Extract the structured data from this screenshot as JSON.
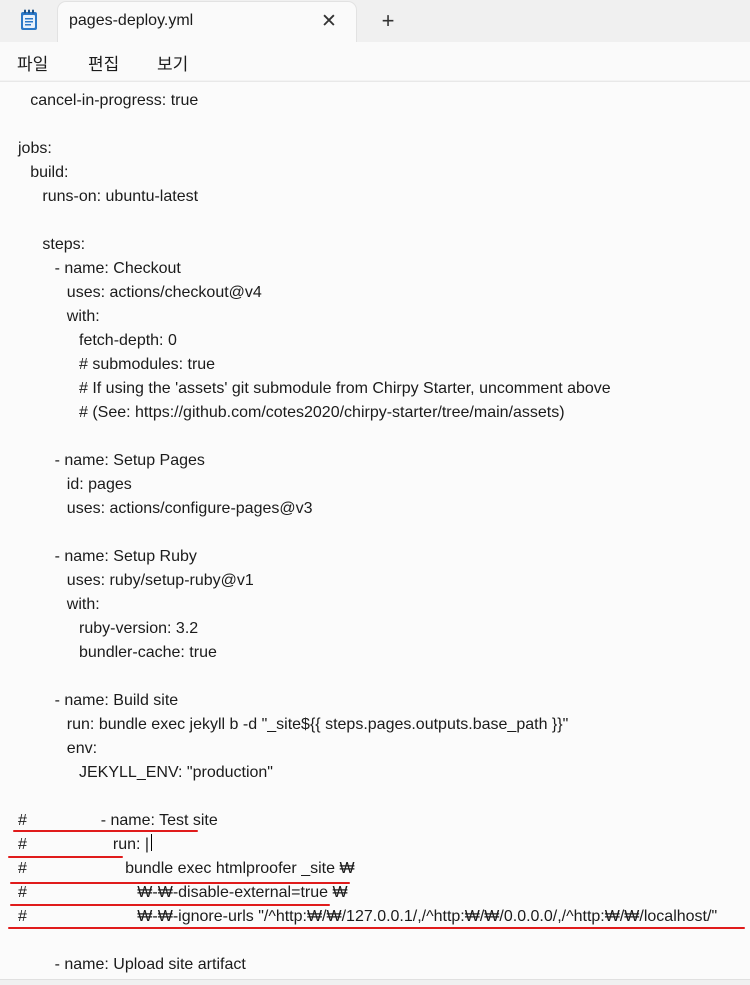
{
  "window": {
    "tab_title": "pages-deploy.yml",
    "close_glyph": "✕",
    "new_tab_glyph": "+"
  },
  "menu": {
    "file": "파일",
    "edit": "편집",
    "view": "보기"
  },
  "colors": {
    "annotation": "#e01b1b",
    "app_icon": "#1f6fb5"
  },
  "lines": [
    "  cancel-in-progress: true",
    "",
    "jobs:",
    "  build:",
    "    runs-on: ubuntu-latest",
    "",
    "    steps:",
    "      - name: Checkout",
    "        uses: actions/checkout@v4",
    "        with:",
    "          fetch-depth: 0",
    "          # submodules: true",
    "          # If using the 'assets' git submodule from Chirpy Starter, uncomment above",
    "          # (See: https://github.com/cotes2020/chirpy-starter/tree/main/assets)",
    "",
    "      - name: Setup Pages",
    "        id: pages",
    "        uses: actions/configure-pages@v3",
    "",
    "      - name: Setup Ruby",
    "        uses: ruby/setup-ruby@v1",
    "        with:",
    "          ruby-version: 3.2",
    "          bundler-cache: true",
    "",
    "      - name: Build site",
    "        run: bundle exec jekyll b -d \"_site${{ steps.pages.outputs.base_path }}\"",
    "        env:",
    "          JEKYLL_ENV: \"production\"",
    "",
    "#       - name: Test site",
    "#         run: |",
    "#           bundle exec htmlproofer _site ₩",
    "#             ₩-₩-disable-external=true ₩",
    "#             ₩-₩-ignore-urls \"/^http:₩/₩/127.0.0.1/,/^http:₩/₩/0.0.0.0/,/^http:₩/₩/localhost/\"",
    "",
    "      - name: Upload site artifact"
  ]
}
